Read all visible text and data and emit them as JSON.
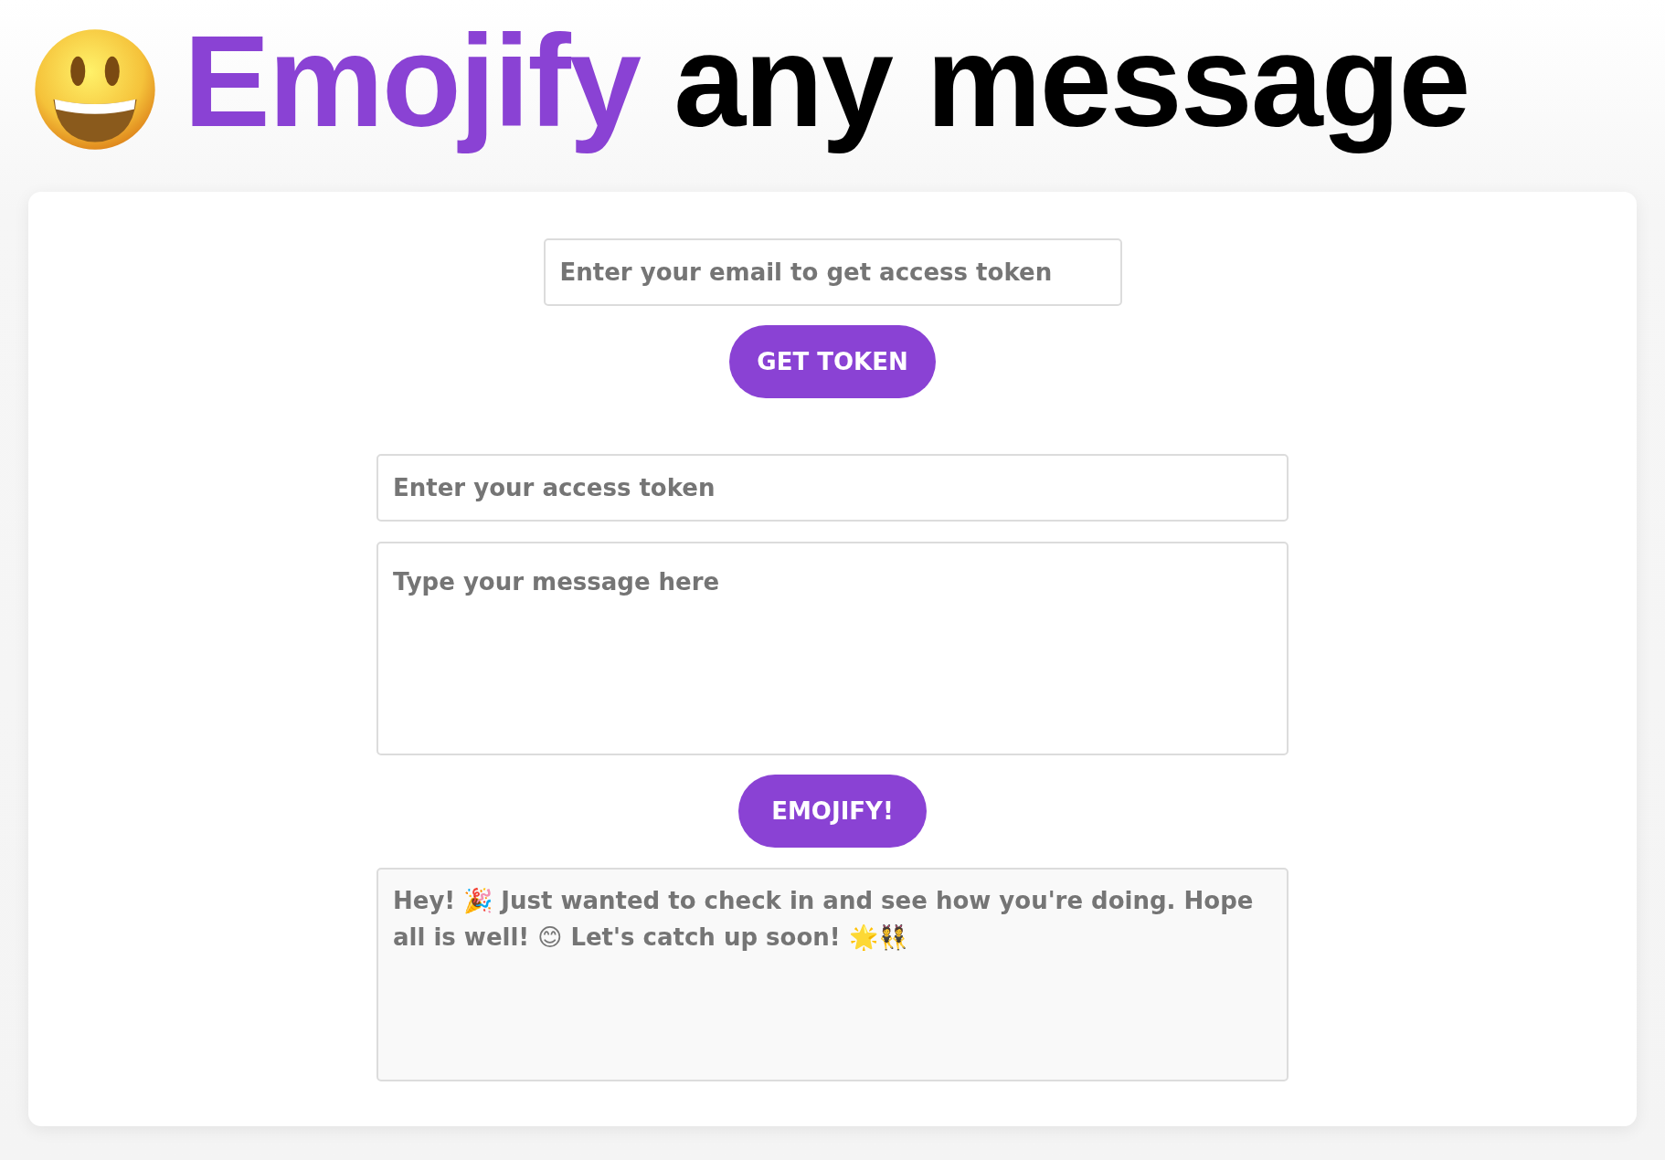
{
  "header": {
    "highlight": "Emojify",
    "rest": "any message"
  },
  "email_field": {
    "placeholder": "Enter your email to get access token"
  },
  "get_token_button": "GET TOKEN",
  "token_field": {
    "placeholder": "Enter your access token"
  },
  "message_field": {
    "placeholder": "Type your message here"
  },
  "emojify_button": "EMOJIFY!",
  "output": "Hey! 🎉 Just wanted to check in and see how you're doing. Hope all is well! 😊 Let's catch up soon! 🌟👯"
}
